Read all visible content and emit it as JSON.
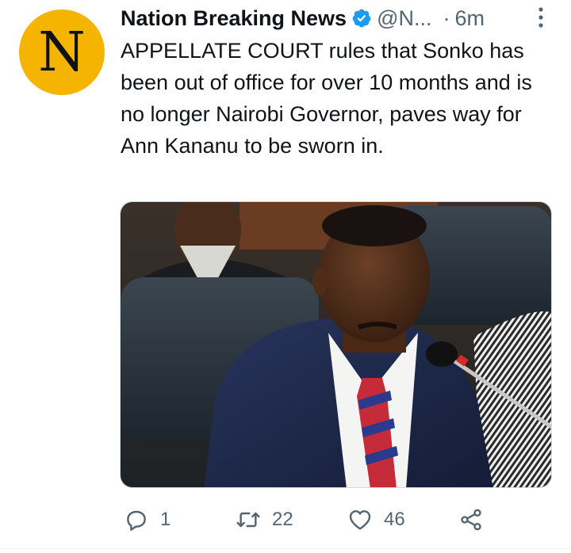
{
  "tweet": {
    "author_name": "Nation Breaking News",
    "handle": "@N...",
    "separator": "·",
    "time": "6m",
    "avatar_letter": "N",
    "text": "APPELLATE COURT rules that Sonko has been out of office for over 10 months and is no longer Nairobi Governor, paves way for Ann Kananu to be sworn in."
  },
  "actions": {
    "reply_count": "1",
    "retweet_count": "22",
    "like_count": "46"
  },
  "colors": {
    "avatar_bg": "#f4b400",
    "verified": "#1d9bf0",
    "secondary_text": "#536471"
  },
  "icons": [
    "verified-badge-icon",
    "more-icon",
    "reply-icon",
    "retweet-icon",
    "like-icon",
    "share-icon"
  ]
}
